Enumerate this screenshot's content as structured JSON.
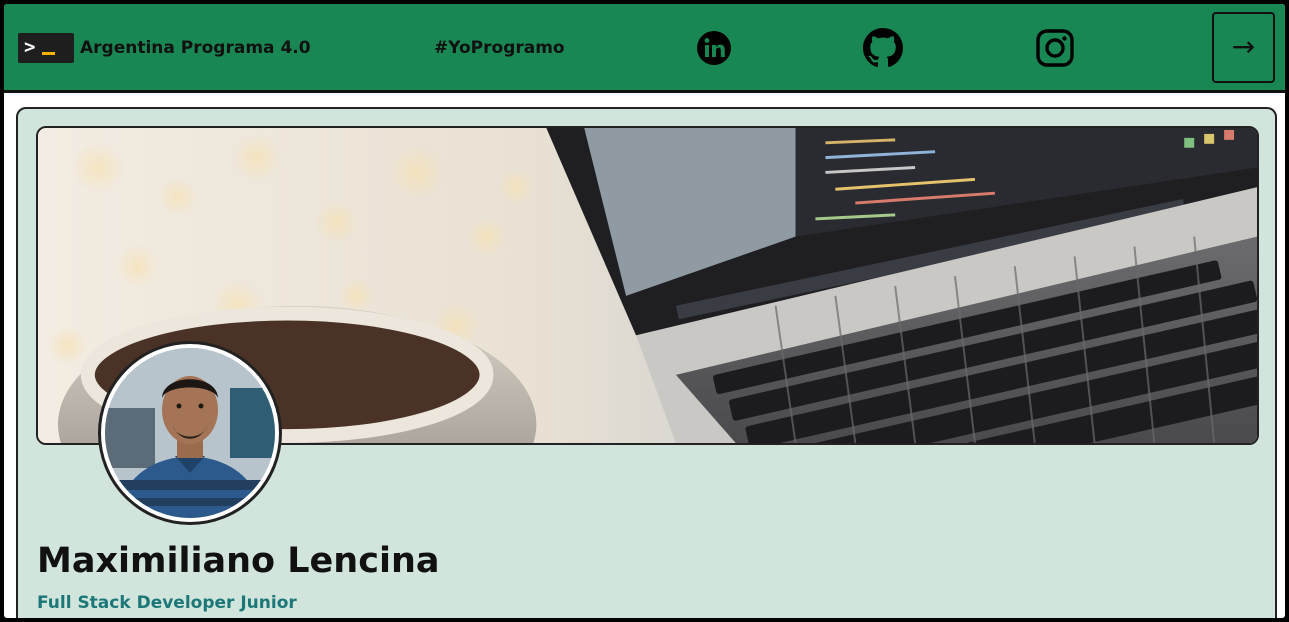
{
  "navbar": {
    "brand_title": "Argentina Programa 4.0",
    "brand_logo_text": ">",
    "hashtag": "#YoProgramo",
    "social": [
      {
        "name": "linkedin",
        "icon": "linkedin-icon"
      },
      {
        "name": "github",
        "icon": "github-icon"
      },
      {
        "name": "instagram",
        "icon": "instagram-icon"
      }
    ],
    "logout_icon": "arrow-right-icon",
    "logout_symbol": "→"
  },
  "profile": {
    "name": "Maximiliano Lencina",
    "role": "Full Stack Developer Junior"
  },
  "colors": {
    "navbar_bg": "#198754",
    "card_bg": "#d2e5dc",
    "role_text": "#1b7778",
    "logo_cursor": "#f4b400"
  }
}
